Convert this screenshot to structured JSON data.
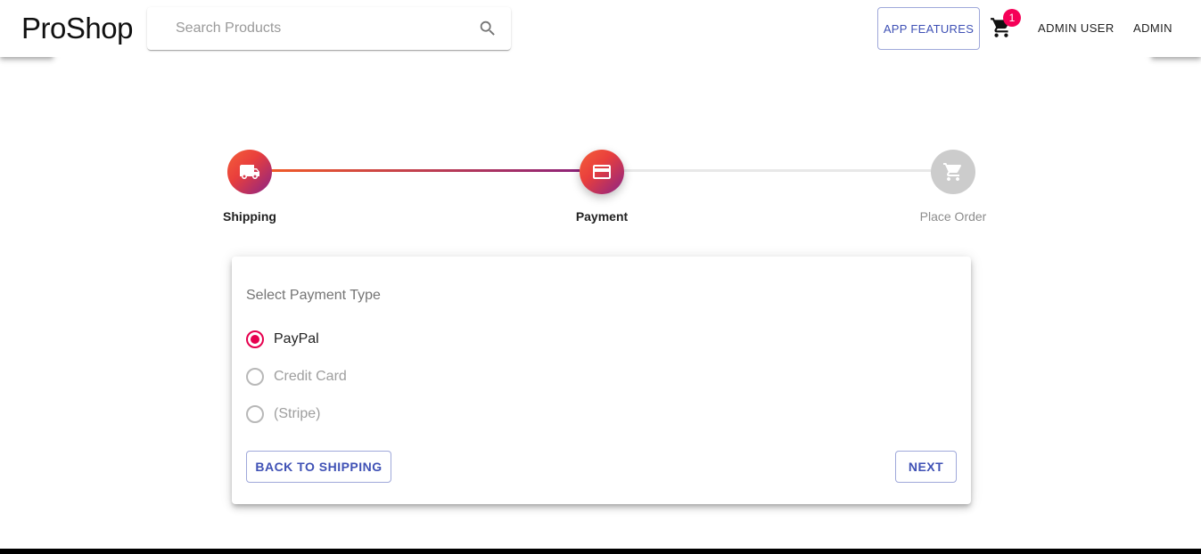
{
  "header": {
    "brand": "ProShop",
    "search_placeholder": "Search Products",
    "features_label": "APP FEATURES",
    "cart_count": "1",
    "user_label": "ADMIN USER",
    "admin_label": "ADMIN"
  },
  "stepper": {
    "steps": [
      {
        "label": "Shipping",
        "icon": "truck-icon",
        "state": "completed"
      },
      {
        "label": "Payment",
        "icon": "credit-card-icon",
        "state": "active"
      },
      {
        "label": "Place Order",
        "icon": "cart-icon",
        "state": "pending"
      }
    ]
  },
  "payment": {
    "title": "Select Payment Type",
    "options": [
      {
        "label": "PayPal",
        "selected": true,
        "disabled": false
      },
      {
        "label": "Credit Card",
        "selected": false,
        "disabled": true
      },
      {
        "label": "(Stripe)",
        "selected": false,
        "disabled": true
      }
    ],
    "back_label": "BACK TO SHIPPING",
    "next_label": "NEXT"
  },
  "colors": {
    "primary": "#3f51b5",
    "accent": "#f50057",
    "radio_selected": "#e6004e",
    "gradient_start": "#f05a28",
    "gradient_end": "#8a2387"
  }
}
